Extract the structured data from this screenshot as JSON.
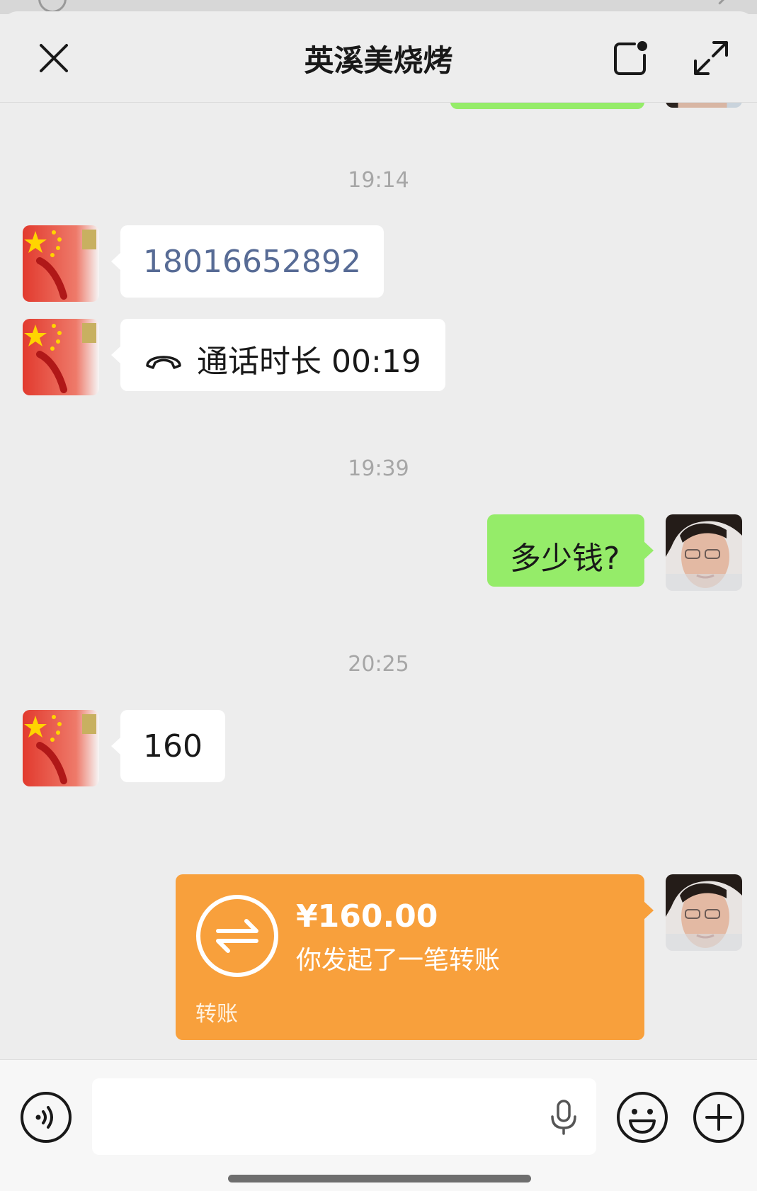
{
  "header": {
    "title": "英溪美烧烤",
    "close_icon": "close-icon",
    "note_icon": "note-icon",
    "expand_icon": "expand-icon"
  },
  "messages": [
    {
      "type": "timestamp",
      "text": "19:14"
    },
    {
      "type": "text",
      "side": "left",
      "text": "18016652892"
    },
    {
      "type": "call",
      "side": "left",
      "text": "通话时长 00:19",
      "icon": "phone-hangup-icon"
    },
    {
      "type": "timestamp",
      "text": "19:39"
    },
    {
      "type": "text",
      "side": "right",
      "text": "多少钱?"
    },
    {
      "type": "timestamp",
      "text": "20:25"
    },
    {
      "type": "text",
      "side": "left",
      "text": "160"
    },
    {
      "type": "transfer",
      "side": "right",
      "amount": "¥160.00",
      "description": "你发起了一笔转账",
      "label": "转账",
      "icon": "transfer-icon"
    }
  ],
  "input_bar": {
    "voice_icon": "voice-mode-icon",
    "text_value": "",
    "mic_icon": "microphone-icon",
    "emoji_icon": "emoji-icon",
    "plus_icon": "plus-icon"
  },
  "colors": {
    "background": "#ededed",
    "outgoing_bubble": "#95ec69",
    "incoming_bubble": "#ffffff",
    "transfer_card": "#f8a03c",
    "phone_link": "#576b95"
  }
}
